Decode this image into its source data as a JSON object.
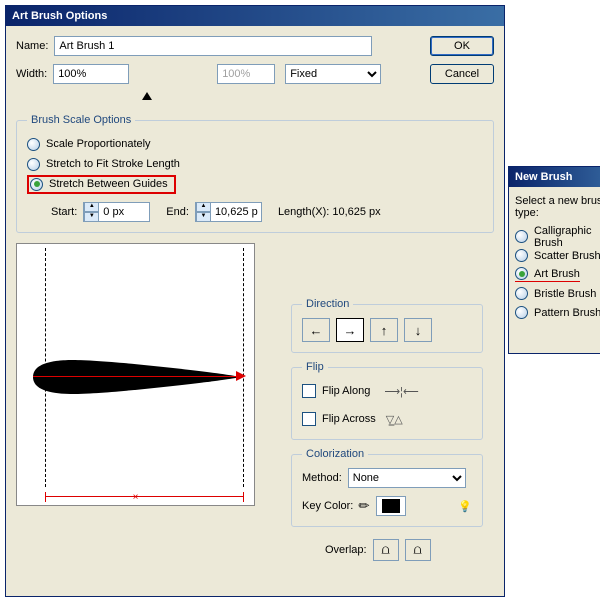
{
  "main": {
    "title": "Art Brush Options",
    "name_label": "Name:",
    "name_value": "Art Brush 1",
    "ok": "OK",
    "cancel": "Cancel",
    "width_label": "Width:",
    "width_value": "100%",
    "width_disabled": "100%",
    "fixed": "Fixed"
  },
  "scale": {
    "legend": "Brush Scale Options",
    "opt1": "Scale Proportionately",
    "opt2": "Stretch to Fit Stroke Length",
    "opt3": "Stretch Between Guides",
    "start_label": "Start:",
    "start_value": "0 px",
    "end_label": "End:",
    "end_value": "10,625 p",
    "length_label": "Length(X):  10,625 px"
  },
  "direction": {
    "legend": "Direction",
    "left": "←",
    "right": "→",
    "up": "↑",
    "down": "↓"
  },
  "flip": {
    "legend": "Flip",
    "along": "Flip Along",
    "across": "Flip Across"
  },
  "color": {
    "legend": "Colorization",
    "method_label": "Method:",
    "method_value": "None",
    "key_label": "Key Color:"
  },
  "overlap": {
    "label": "Overlap:"
  },
  "newbrush": {
    "title": "New Brush",
    "prompt": "Select a new brush type:",
    "opt1": "Calligraphic Brush",
    "opt2": "Scatter Brush",
    "opt3": "Art Brush",
    "opt4": "Bristle Brush",
    "opt5": "Pattern Brush"
  }
}
